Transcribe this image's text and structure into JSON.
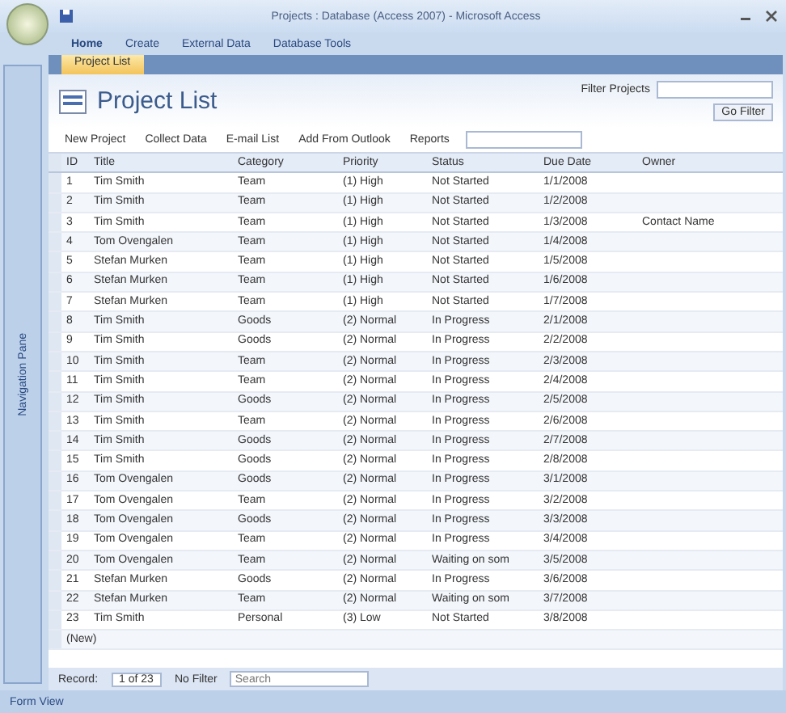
{
  "window": {
    "title": "Projects : Database (Access 2007) - Microsoft Access"
  },
  "ribbon_tabs": [
    {
      "label": "Home",
      "selected": true
    },
    {
      "label": "Create",
      "selected": false
    },
    {
      "label": "External Data",
      "selected": false
    },
    {
      "label": "Database Tools",
      "selected": false
    }
  ],
  "document_tabs": [
    {
      "label": "Project List",
      "selected": true
    }
  ],
  "navigation_pane": {
    "label": "Navigation Pane"
  },
  "form": {
    "title": "Project List",
    "filter_label": "Filter Projects",
    "go_label": "Go Filter",
    "toolbar": [
      "New Project",
      "Collect Data",
      "E-mail List",
      "Add From Outlook",
      "Reports"
    ],
    "columns": [
      "ID",
      "Title",
      "Category",
      "Priority",
      "Status",
      "Due Date",
      "Owner"
    ],
    "rows": [
      {
        "id": "1",
        "title": "Tim Smith",
        "category": "Team",
        "priority": "(1) High",
        "status": "Not Started",
        "date": "1/1/2008",
        "owner": ""
      },
      {
        "id": "2",
        "title": "Tim Smith",
        "category": "Team",
        "priority": "(1) High",
        "status": "Not Started",
        "date": "1/2/2008",
        "owner": ""
      },
      {
        "id": "3",
        "title": "Tim Smith",
        "category": "Team",
        "priority": "(1) High",
        "status": "Not Started",
        "date": "1/3/2008",
        "owner": "Contact Name"
      },
      {
        "id": "4",
        "title": "Tom Ovengalen",
        "category": "Team",
        "priority": "(1) High",
        "status": "Not Started",
        "date": "1/4/2008",
        "owner": ""
      },
      {
        "id": "5",
        "title": "Stefan Murken",
        "category": "Team",
        "priority": "(1) High",
        "status": "Not Started",
        "date": "1/5/2008",
        "owner": ""
      },
      {
        "id": "6",
        "title": "Stefan Murken",
        "category": "Team",
        "priority": "(1) High",
        "status": "Not Started",
        "date": "1/6/2008",
        "owner": ""
      },
      {
        "id": "7",
        "title": "Stefan Murken",
        "category": "Team",
        "priority": "(1) High",
        "status": "Not Started",
        "date": "1/7/2008",
        "owner": ""
      },
      {
        "id": "8",
        "title": "Tim Smith",
        "category": "Goods",
        "priority": "(2) Normal",
        "status": "In Progress",
        "date": "2/1/2008",
        "owner": ""
      },
      {
        "id": "9",
        "title": "Tim Smith",
        "category": "Goods",
        "priority": "(2) Normal",
        "status": "In Progress",
        "date": "2/2/2008",
        "owner": ""
      },
      {
        "id": "10",
        "title": "Tim Smith",
        "category": "Team",
        "priority": "(2) Normal",
        "status": "In Progress",
        "date": "2/3/2008",
        "owner": ""
      },
      {
        "id": "11",
        "title": "Tim Smith",
        "category": "Team",
        "priority": "(2) Normal",
        "status": "In Progress",
        "date": "2/4/2008",
        "owner": ""
      },
      {
        "id": "12",
        "title": "Tim Smith",
        "category": "Goods",
        "priority": "(2) Normal",
        "status": "In Progress",
        "date": "2/5/2008",
        "owner": ""
      },
      {
        "id": "13",
        "title": "Tim Smith",
        "category": "Team",
        "priority": "(2) Normal",
        "status": "In Progress",
        "date": "2/6/2008",
        "owner": ""
      },
      {
        "id": "14",
        "title": "Tim Smith",
        "category": "Goods",
        "priority": "(2) Normal",
        "status": "In Progress",
        "date": "2/7/2008",
        "owner": ""
      },
      {
        "id": "15",
        "title": "Tim Smith",
        "category": "Goods",
        "priority": "(2) Normal",
        "status": "In Progress",
        "date": "2/8/2008",
        "owner": ""
      },
      {
        "id": "16",
        "title": "Tom Ovengalen",
        "category": "Goods",
        "priority": "(2) Normal",
        "status": "In Progress",
        "date": "3/1/2008",
        "owner": ""
      },
      {
        "id": "17",
        "title": "Tom Ovengalen",
        "category": "Team",
        "priority": "(2) Normal",
        "status": "In Progress",
        "date": "3/2/2008",
        "owner": ""
      },
      {
        "id": "18",
        "title": "Tom Ovengalen",
        "category": "Goods",
        "priority": "(2) Normal",
        "status": "In Progress",
        "date": "3/3/2008",
        "owner": ""
      },
      {
        "id": "19",
        "title": "Tom Ovengalen",
        "category": "Team",
        "priority": "(2) Normal",
        "status": "In Progress",
        "date": "3/4/2008",
        "owner": ""
      },
      {
        "id": "20",
        "title": "Tom Ovengalen",
        "category": "Team",
        "priority": "(2) Normal",
        "status": "Waiting on som",
        "date": "3/5/2008",
        "owner": ""
      },
      {
        "id": "21",
        "title": "Stefan Murken",
        "category": "Goods",
        "priority": "(2) Normal",
        "status": "In Progress",
        "date": "3/6/2008",
        "owner": ""
      },
      {
        "id": "22",
        "title": "Stefan Murken",
        "category": "Team",
        "priority": "(2) Normal",
        "status": "Waiting on som",
        "date": "3/7/2008",
        "owner": ""
      },
      {
        "id": "23",
        "title": "Tim Smith",
        "category": "Personal",
        "priority": "(3) Low",
        "status": "Not Started",
        "date": "3/8/2008",
        "owner": ""
      }
    ],
    "new_row_label": "(New)"
  },
  "record_navigator": {
    "label": "Record:",
    "position": "1 of 23",
    "filter": "No Filter",
    "search_placeholder": "Search"
  },
  "status_bar": {
    "text": "Form View"
  }
}
